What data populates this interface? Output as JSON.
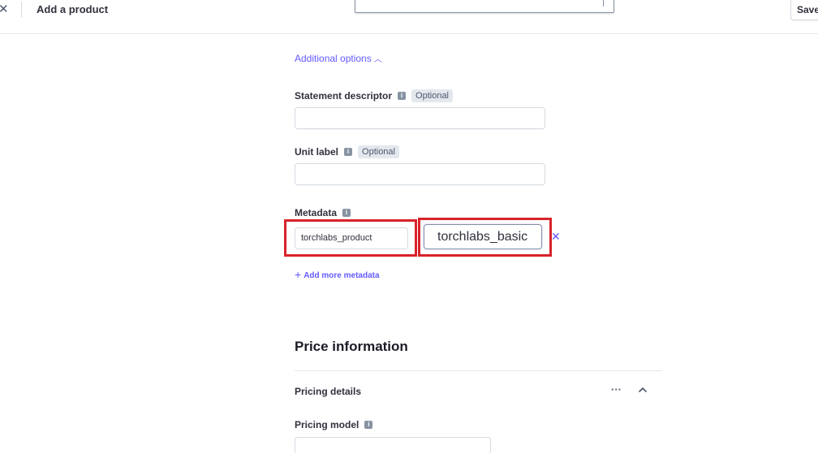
{
  "header": {
    "close_icon": "close-icon",
    "title": "Add a product",
    "save_label": "Save"
  },
  "additional_options": {
    "label": "Additional options",
    "icon": "chevron-up-icon"
  },
  "statement_descriptor": {
    "label": "Statement descriptor",
    "badge": "Optional",
    "value": ""
  },
  "unit_label": {
    "label": "Unit label",
    "badge": "Optional",
    "value": ""
  },
  "metadata": {
    "label": "Metadata",
    "key": "torchlabs_product",
    "value": "torchlabs_basic",
    "add_more": "Add more metadata"
  },
  "price_information": {
    "title": "Price information",
    "pricing_details": "Pricing details",
    "pricing_model_label": "Pricing model"
  },
  "colors": {
    "accent": "#635bff",
    "highlight": "#d8232a",
    "text": "#30313d"
  }
}
